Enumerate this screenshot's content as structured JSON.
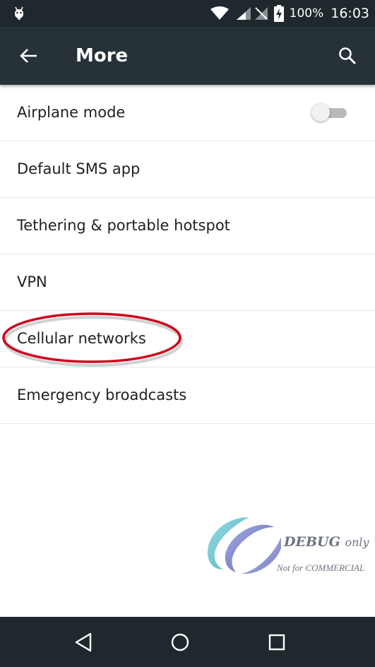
{
  "status_bar": {
    "battery_percent": "100%",
    "time": "16:03",
    "icons": [
      "android-debug-icon",
      "wifi-icon",
      "signal-icon",
      "no-signal-icon",
      "battery-charging-icon"
    ]
  },
  "app_bar": {
    "title": "More",
    "back_icon": "arrow-back-icon",
    "search_icon": "search-icon",
    "background_color": "#263238"
  },
  "settings": {
    "items": [
      {
        "label": "Airplane mode",
        "toggle": "off"
      },
      {
        "label": "Default SMS app"
      },
      {
        "label": "Tethering & portable hotspot"
      },
      {
        "label": "VPN"
      },
      {
        "label": "Cellular networks",
        "highlighted": true
      },
      {
        "label": "Emergency broadcasts"
      }
    ],
    "highlight_color": "#d0021b"
  },
  "watermark": {
    "line1_main": "DEBUG",
    "line1_suffix": "only",
    "line2": "Not for COMMERCIAL"
  },
  "nav_bar": {
    "buttons": [
      "back-triangle-icon",
      "home-circle-icon",
      "recents-square-icon"
    ]
  }
}
